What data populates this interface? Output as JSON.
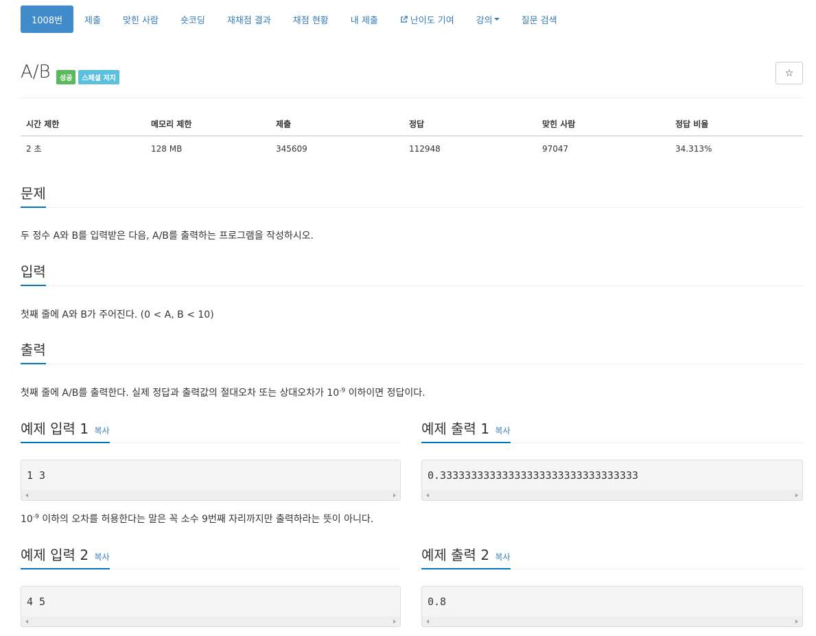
{
  "nav": {
    "items": [
      {
        "label": "1008번",
        "active": true
      },
      {
        "label": "제출"
      },
      {
        "label": "맞힌 사람"
      },
      {
        "label": "숏코딩"
      },
      {
        "label": "재채점 결과"
      },
      {
        "label": "채점 현황"
      },
      {
        "label": "내 제출"
      },
      {
        "label": "난이도 기여",
        "icon": "external-link-icon"
      },
      {
        "label": "강의",
        "dropdown": true
      },
      {
        "label": "질문 검색"
      }
    ]
  },
  "problem": {
    "title": "A/B",
    "labels": [
      "성공",
      "스페셜 저지"
    ],
    "star_symbol": "☆"
  },
  "info_table": {
    "headers": [
      "시간 제한",
      "메모리 제한",
      "제출",
      "정답",
      "맞힌 사람",
      "정답 비율"
    ],
    "values": [
      "2 초",
      "128 MB",
      "345609",
      "112948",
      "97047",
      "34.313%"
    ]
  },
  "sections": {
    "problem": {
      "title": "문제",
      "text": "두 정수 A와 B를 입력받은 다음, A/B를 출력하는 프로그램을 작성하시오."
    },
    "input": {
      "title": "입력",
      "text": "첫째 줄에 A와 B가 주어진다. (0 < A, B < 10)"
    },
    "output": {
      "title": "출력",
      "text_before": "첫째 줄에 A/B를 출력한다. 실제 정답과 출력값의 절대오차 또는 상대오차가 10",
      "text_exp": "-9",
      "text_after": " 이하이면 정답이다."
    }
  },
  "samples": {
    "copy_label": "복사",
    "input1": {
      "title": "예제 입력 1",
      "content": "1 3"
    },
    "output1": {
      "title": "예제 출력 1",
      "content": "0.33333333333333333333333333333333"
    },
    "note": {
      "before": "10",
      "exp": "-9",
      "after": " 이하의 오차를 허용한다는 말은 꼭 소수 9번째 자리까지만 출력하라는 뜻이 아니다."
    },
    "input2": {
      "title": "예제 입력 2",
      "content": "4 5"
    },
    "output2": {
      "title": "예제 출력 2",
      "content": "0.8"
    }
  }
}
